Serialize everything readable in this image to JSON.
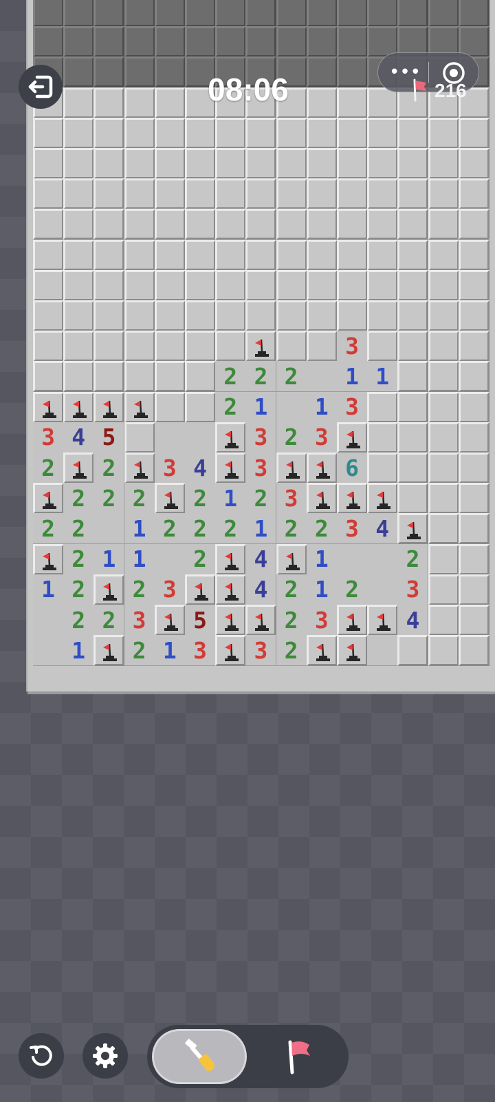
{
  "game": "Minesweeper",
  "timer": "08:06",
  "mines_remaining": "216",
  "colors": {
    "n1": "#2f4ec6",
    "n2": "#3d8a3a",
    "n3": "#d23b36",
    "n4": "#3a3f96",
    "n5": "#8b1a14",
    "n6": "#2e8a8c",
    "flag": "#e23b3b",
    "mine": "#262626"
  },
  "board": {
    "columns": 15,
    "rows": [
      "###############",
      "###############",
      "###############",
      "###############",
      "###############",
      "###############",
      "###############",
      "###############",
      "###############",
      "###############",
      "###############",
      "#######F##3####",
      "######222.11###",
      "FFFF##21.13####",
      "345#..F323F####",
      "2F2F34F3FF6####",
      "F222F2123FFF###",
      "22.122212234F##",
      "F211.2F4F1..2##",
      "12F23FF4212.3##",
      ".223F5FF23FF4##",
      ".1F213F32FF.###"
    ],
    "legend": {
      "#": "unrevealed",
      "F": "flagged mine",
      ".": "empty revealed",
      "1-8": "adjacent mine count"
    }
  },
  "controls": {
    "exit": "exit-icon",
    "restart": "restart-icon",
    "settings": "gear-icon",
    "dig_mode": "shovel-icon",
    "flag_mode": "flag-icon",
    "active_mode": "dig"
  }
}
